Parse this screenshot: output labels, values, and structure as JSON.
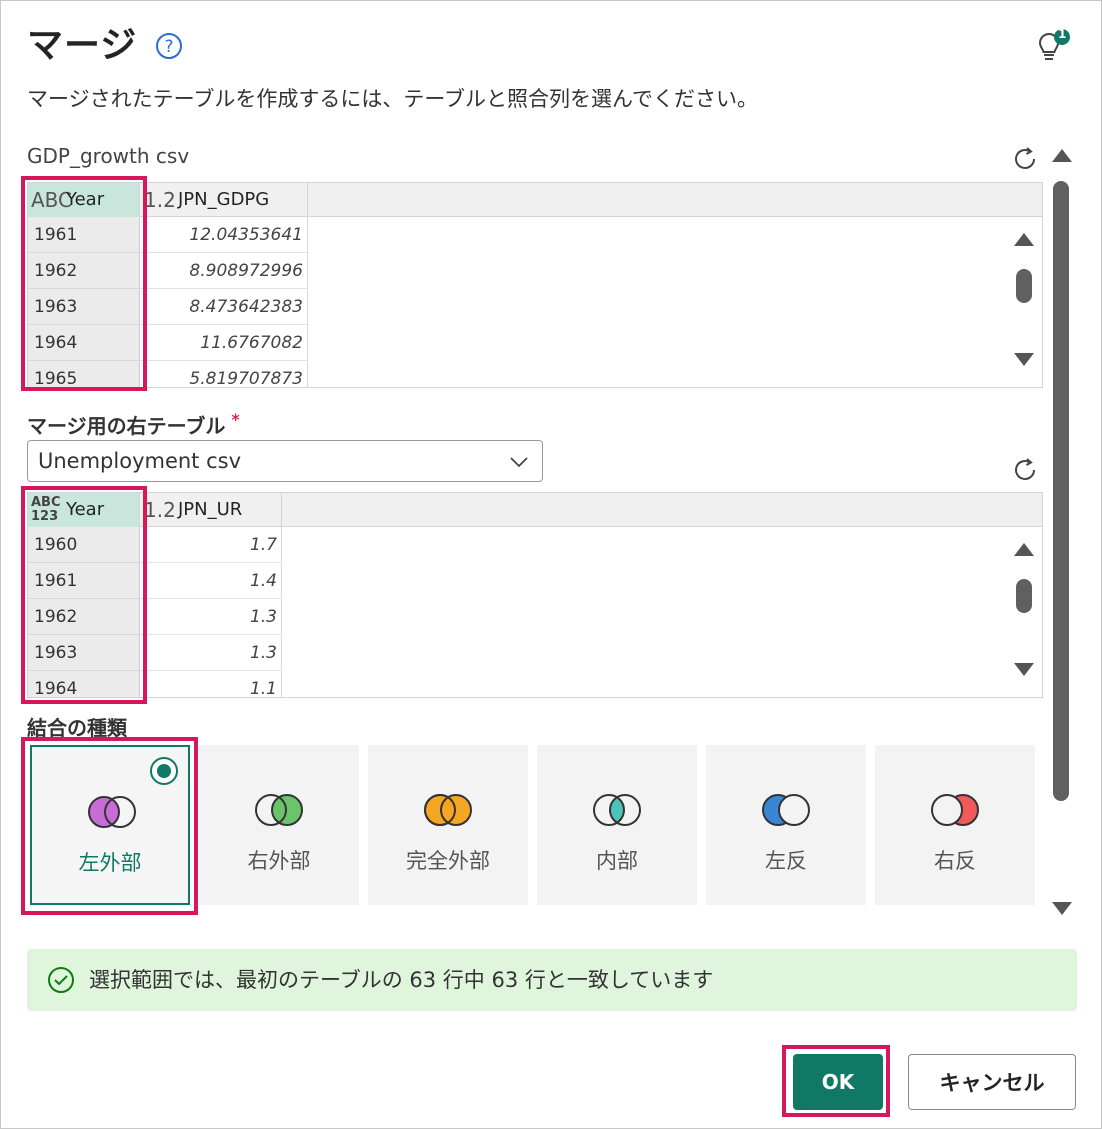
{
  "dialog": {
    "title": "マージ",
    "subtitle": "マージされたテーブルを作成するには、テーブルと照合列を選んでください。",
    "bulb_badge": "1"
  },
  "left_table": {
    "name": "GDP_growth csv",
    "columns": [
      {
        "type": "ABC",
        "name": "Year"
      },
      {
        "type": "1.2",
        "name": "JPN_GDPG"
      }
    ],
    "rows": [
      [
        "1961",
        "12.04353641"
      ],
      [
        "1962",
        "8.908972996"
      ],
      [
        "1963",
        "8.473642383"
      ],
      [
        "1964",
        "11.6767082"
      ],
      [
        "1965",
        "5.819707873"
      ]
    ]
  },
  "right_table": {
    "label": "マージ用の右テーブル",
    "required_mark": "*",
    "selected": "Unemployment csv",
    "columns": [
      {
        "type": "ABC 123",
        "name": "Year"
      },
      {
        "type": "1.2",
        "name": "JPN_UR"
      }
    ],
    "rows": [
      [
        "1960",
        "1.7"
      ],
      [
        "1961",
        "1.4"
      ],
      [
        "1962",
        "1.3"
      ],
      [
        "1963",
        "1.3"
      ],
      [
        "1964",
        "1.1"
      ]
    ]
  },
  "join": {
    "label": "結合の種類",
    "selected_index": 0,
    "options": [
      {
        "label": "左外部",
        "color": "#c86dd7"
      },
      {
        "label": "右外部",
        "color": "#6cc46a"
      },
      {
        "label": "完全外部",
        "color": "#f5a623"
      },
      {
        "label": "内部",
        "color": "#4dc4b8"
      },
      {
        "label": "左反",
        "color": "#3a86d4"
      },
      {
        "label": "右反",
        "color": "#f05a5a"
      }
    ]
  },
  "status": {
    "message": "選択範囲では、最初のテーブルの 63 行中 63 行と一致しています"
  },
  "buttons": {
    "ok": "OK",
    "cancel": "キャンセル"
  },
  "colors": {
    "accent": "#117865",
    "highlight": "#d6175c",
    "status_bg": "#dff6dd"
  }
}
